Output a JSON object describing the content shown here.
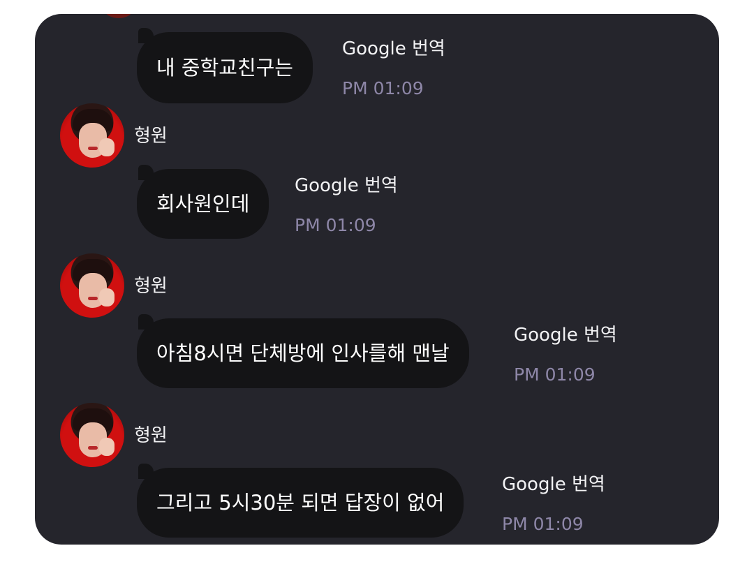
{
  "messages": [
    {
      "sender": "",
      "text": "내 중학교친구는",
      "translate_label": "Google 번역",
      "time": "PM 01:09"
    },
    {
      "sender": "형원",
      "text": "회사원인데",
      "translate_label": "Google 번역",
      "time": "PM 01:09"
    },
    {
      "sender": "형원",
      "text": "아침8시면 단체방에 인사를해 맨날",
      "translate_label": "Google 번역",
      "time": "PM 01:09"
    },
    {
      "sender": "형원",
      "text": "그리고 5시30분 되면 답장이 없어",
      "translate_label": "Google 번역",
      "time": "PM 01:09"
    }
  ],
  "colors": {
    "panel_background": "#25252c",
    "bubble_background": "#141416",
    "timestamp": "#8e87a8",
    "avatar_accent": "#d01010"
  }
}
